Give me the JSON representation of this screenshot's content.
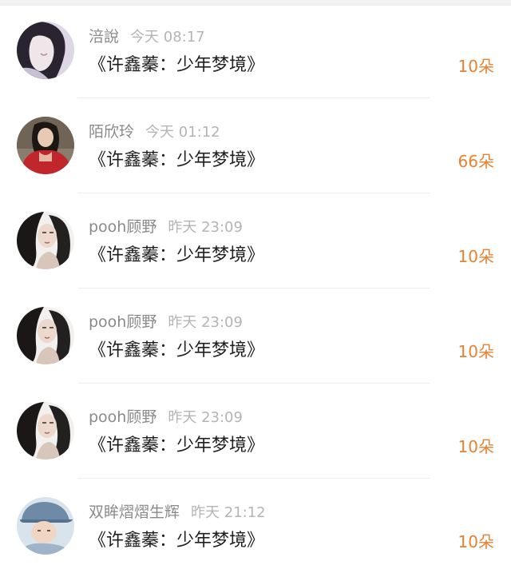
{
  "records": [
    {
      "name": "涪說",
      "time": "今天 08:17",
      "gift": "《许鑫蓁：少年梦境》",
      "count": "10朵",
      "avatar": "avatar-girl-side-profile"
    },
    {
      "name": "陌欣玲",
      "time": "今天 01:12",
      "gift": "《许鑫蓁：少年梦境》",
      "count": "66朵",
      "avatar": "avatar-girl-red-jacket"
    },
    {
      "name": "pooh顾野",
      "time": "昨天 23:09",
      "gift": "《许鑫蓁：少年梦境》",
      "count": "10朵",
      "avatar": "avatar-girl-dark-hair"
    },
    {
      "name": "pooh顾野",
      "time": "昨天 23:09",
      "gift": "《许鑫蓁：少年梦境》",
      "count": "10朵",
      "avatar": "avatar-girl-dark-hair"
    },
    {
      "name": "pooh顾野",
      "time": "昨天 23:09",
      "gift": "《许鑫蓁：少年梦境》",
      "count": "10朵",
      "avatar": "avatar-girl-dark-hair"
    },
    {
      "name": "双眸熠熠生辉",
      "time": "昨天 21:12",
      "gift": "《许鑫蓁：少年梦境》",
      "count": "10朵",
      "avatar": "avatar-boy-cap"
    }
  ]
}
